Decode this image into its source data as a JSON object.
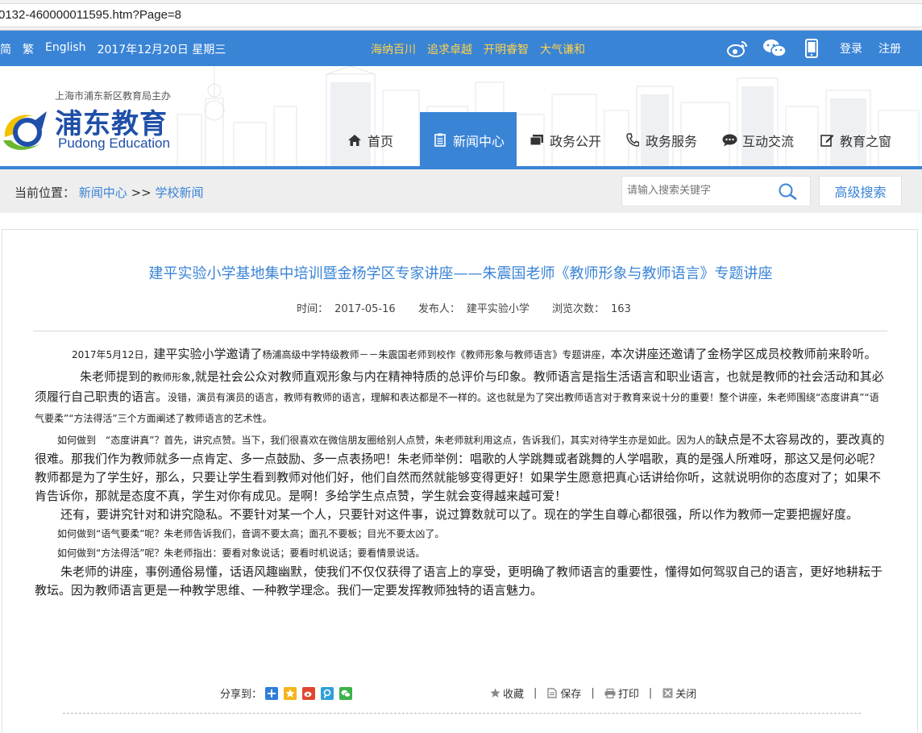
{
  "browser": {
    "url": "0132-460000011595.htm?Page=8"
  },
  "topbar": {
    "simplified": "简",
    "traditional": "繁",
    "english": "English",
    "date": "2017年12月20日 星期三",
    "slogans": [
      "海纳百川",
      "追求卓越",
      "开明睿智",
      "大气谦和"
    ],
    "login": "登录",
    "register": "注册",
    "icons": [
      "weibo-icon",
      "wechat-icon",
      "mobile-icon"
    ]
  },
  "header": {
    "logo_sub": "上海市浦东新区教育局主办",
    "logo_main": "浦东教育",
    "logo_en": "Pudong Education"
  },
  "nav": {
    "items": [
      {
        "label": "首页",
        "icon": "home-icon"
      },
      {
        "label": "新闻中心",
        "icon": "document-icon",
        "active": true
      },
      {
        "label": "政务公开",
        "icon": "folder-icon"
      },
      {
        "label": "政务服务",
        "icon": "phone-icon"
      },
      {
        "label": "互动交流",
        "icon": "chat-icon"
      },
      {
        "label": "教育之窗",
        "icon": "edit-icon"
      }
    ]
  },
  "breadcrumb": {
    "prefix": "当前位置：",
    "level1": "新闻中心",
    "separator": ">>",
    "level2": "学校新闻"
  },
  "search": {
    "placeholder": "请输入搜索关键字",
    "advanced_label": "高级搜索"
  },
  "article": {
    "title": "建平实验小学基地集中培训暨金杨学区专家讲座——朱震国老师《教师形象与教师语言》专题讲座",
    "time_label": "时间：",
    "time": "2017-05-16",
    "publisher_label": "发布人：",
    "publisher": "建平实验小学",
    "views_label": "浏览次数：",
    "views": "163",
    "p1a": "2017年5月12日，",
    "p1b": "建平实验小学邀请了",
    "p1c": "杨浦高级中学特级教师－－朱震国老师到校作《教师形象与教师语言》专题讲座，",
    "p1d": "本次讲座还邀请了金杨学区成员校教师前来聆听。",
    "p2a": "朱老师提到的",
    "p2b": "教师形象",
    "p2c": ",就是社会公众对教师直观形象与内在精神特质的总评价与印象。教师语言是指生活语言和职业语言，也就是教师的社会活动和其必须履行自己职责的语言。",
    "p2d": "没错，演员有演员的语言，教师有教师的语言，理解和表达都是不一样的。这也就是为了突出教师语言对于教育来说十分的重要！整个讲座，朱老师围绕“态度讲真”“语气要柔”“方法得活”三个方面阐述了教师语言的艺术性。",
    "p3a": "如何做到　“态度讲真”？首先，讲究点赞。当下，我们很喜欢在微信朋友圈给别人点赞，朱老师就利用这点，告诉我们，其实对待学生亦是如此。因为人的",
    "p3b": "缺点是不太容易改的，要改真的很难。那我们作为教师就多一点肯定、多一点鼓励、多一点表扬吧！朱老师举例：唱歌的人学跳舞或者跳舞的人学唱歌，真的是强人所难呀，那这又是何必呢？教师都是为了学生好，那么，只要让学生看到教师对他们好，他们自然而然就能够变得更好！如果学生愿意把真心话讲给你听，这就说明你的态度对了；如果不肯告诉你，那就是态度不真，学生对你有成见。是啊！多给学生点点赞，学生就会变得越来越可爱！",
    "p4": "还有，要讲究针对和讲究隐私。不要针对某一个人，只要针对这件事，说过算数就可以了。现在的学生自尊心都很强，所以作为教师一定要把握好度。",
    "p5": "如何做到“语气要柔”呢？朱老师告诉我们，音调不要太高；面孔不要板；目光不要太凶了。",
    "p6": "如何做到“方法得活”呢？朱老师指出：要看对象说话；要看时机说话；要看情景说话。",
    "p7": "朱老师的讲座，事例通俗易懂，话语风趣幽默，使我们不仅仅获得了语言上的享受，更明确了教师语言的重要性，懂得如何驾驭自己的语言，更好地耕耘于教坛。因为教师语言更是一种教学思维、一种教学理念。我们一定要发挥教师独特的语言魅力。"
  },
  "share": {
    "label": "分享到：",
    "icons": [
      "qzone-plus-icon",
      "qq-space-icon",
      "weibo-share-icon",
      "tencent-weibo-icon",
      "wechat-share-icon"
    ]
  },
  "actions": {
    "favorite": "收藏",
    "save": "保存",
    "print": "打印",
    "close": "关闭",
    "separator": "|"
  }
}
